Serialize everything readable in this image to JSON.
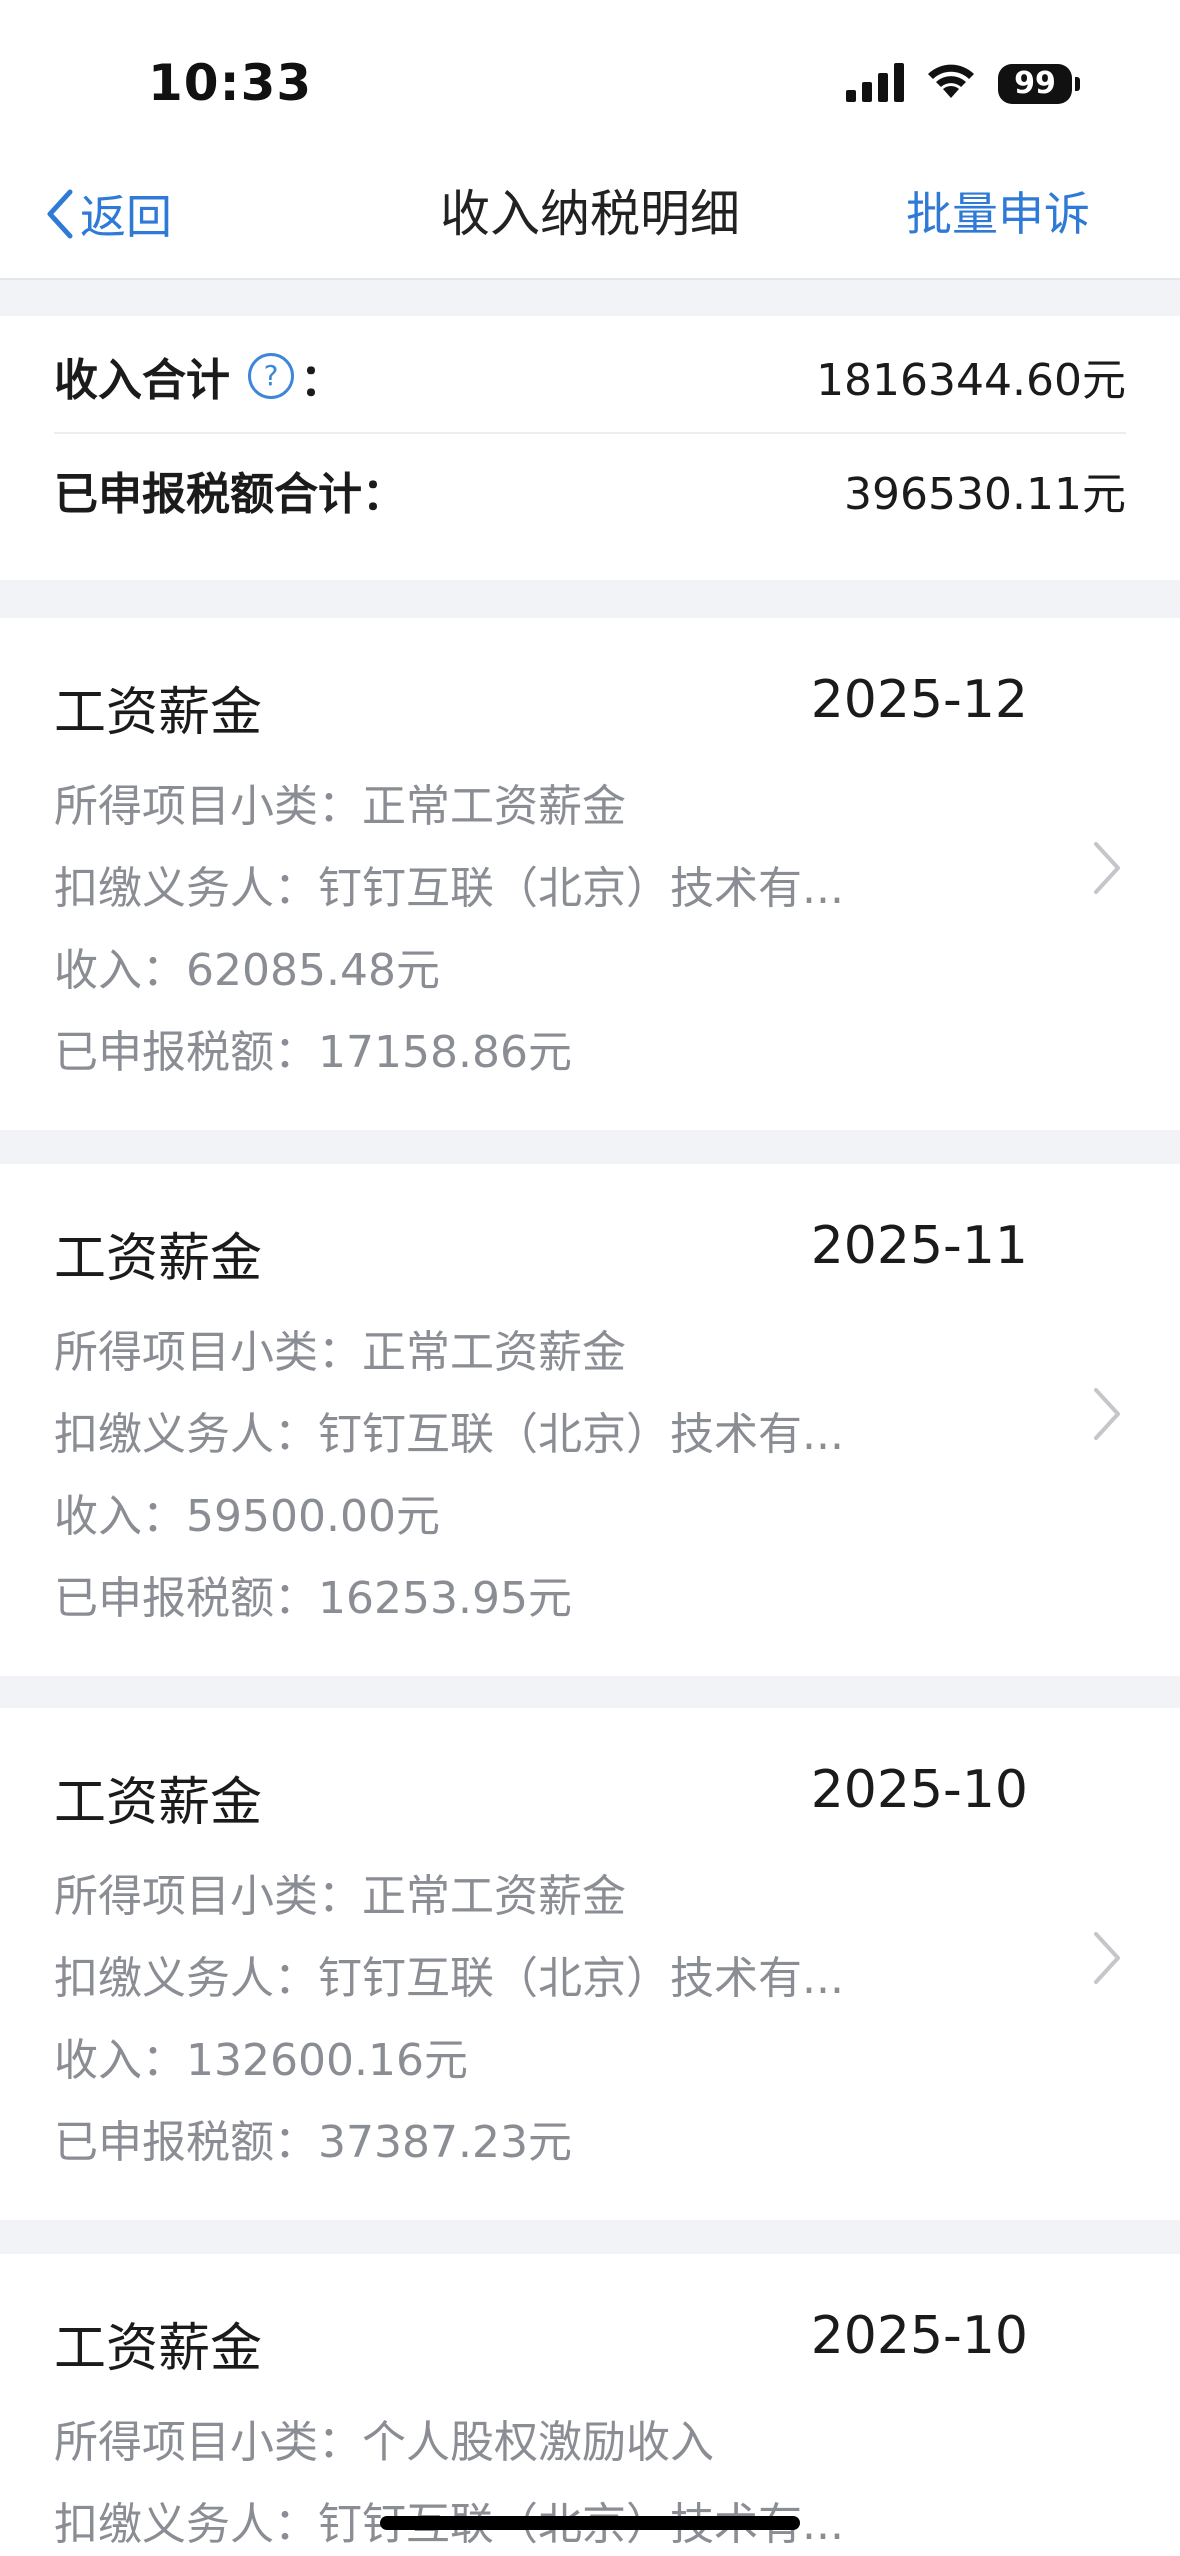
{
  "status_bar": {
    "time": "10:33",
    "battery": "99"
  },
  "nav": {
    "back_label": "返回",
    "title": "收入纳税明细",
    "action_label": "批量申诉"
  },
  "summary": {
    "income_label": "收入合计",
    "income_colon": "：",
    "income_value": "1816344.60元",
    "tax_label": "已申报税额合计：",
    "tax_value": "396530.11元"
  },
  "records": [
    {
      "title": "工资薪金",
      "date": "2025-12",
      "subcategory": "所得项目小类：正常工资薪金",
      "withholder": "扣缴义务人：钉钉互联（北京）技术有...",
      "income": "收入：62085.48元",
      "tax": "已申报税额：17158.86元"
    },
    {
      "title": "工资薪金",
      "date": "2025-11",
      "subcategory": "所得项目小类：正常工资薪金",
      "withholder": "扣缴义务人：钉钉互联（北京）技术有...",
      "income": "收入：59500.00元",
      "tax": "已申报税额：16253.95元"
    },
    {
      "title": "工资薪金",
      "date": "2025-10",
      "subcategory": "所得项目小类：正常工资薪金",
      "withholder": "扣缴义务人：钉钉互联（北京）技术有...",
      "income": "收入：132600.16元",
      "tax": "已申报税额：37387.23元"
    },
    {
      "title": "工资薪金",
      "date": "2025-10",
      "subcategory": "所得项目小类：个人股权激励收入",
      "withholder": "扣缴义务人：钉钉互联（北京）技术有...",
      "income": "",
      "tax": ""
    }
  ],
  "colors": {
    "accent": "#2f7ad6",
    "secondary_text": "#8a8d93",
    "background": "#f2f3f7"
  }
}
